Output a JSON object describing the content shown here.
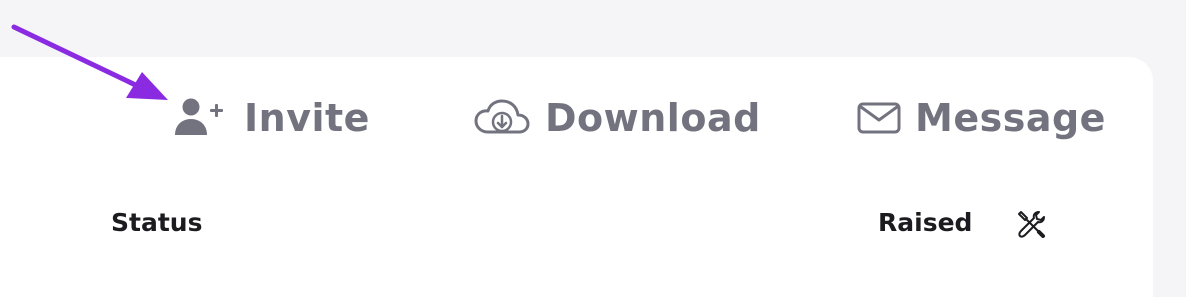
{
  "actions": {
    "invite": {
      "label": "Invite",
      "icon": "add-user-icon"
    },
    "download": {
      "label": "Download",
      "icon": "cloud-download-icon"
    },
    "message": {
      "label": "Message",
      "icon": "envelope-icon"
    }
  },
  "table": {
    "status_label": "Status",
    "raised_label": "Raised",
    "tools_icon": "tools-icon"
  },
  "annotation": {
    "arrow_color": "#8a2be2"
  },
  "colors": {
    "background": "#f5f5f7",
    "card": "#ffffff",
    "action_text": "#737380",
    "row_text": "#1b1b20"
  }
}
